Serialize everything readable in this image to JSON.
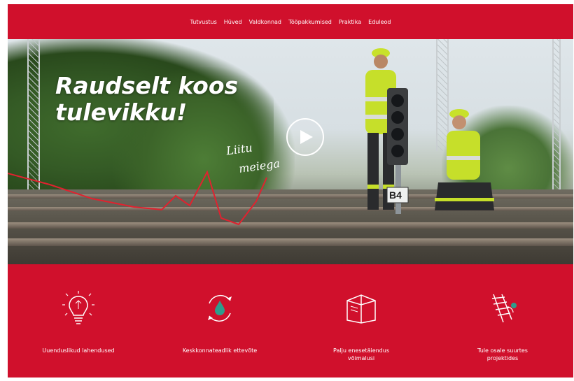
{
  "nav": {
    "items": [
      "Tutvustus",
      "Hüved",
      "Valdkonnad",
      "Tööpakkumised",
      "Praktika",
      "Eduleod"
    ]
  },
  "hero": {
    "title_line1": "Raudselt koos",
    "title_line2": "tulevikku!",
    "signature_line1": "Liitu",
    "signature_line2": "meiega",
    "signal_plate": "B4",
    "play_icon": "play-icon"
  },
  "features": [
    {
      "icon": "lightbulb-icon",
      "label": "Uuenduslikud lahendused"
    },
    {
      "icon": "eco-cycle-icon",
      "label": "Keskkonnateadlik ettevõte"
    },
    {
      "icon": "book-icon",
      "label": "Palju enesetäiendus võimalusi"
    },
    {
      "icon": "railway-track-icon",
      "label": "Tule osale suurtes projektides"
    }
  ],
  "colors": {
    "brand_red": "#d0102c",
    "icon_accent": "#2f9c8c",
    "white": "#ffffff"
  }
}
